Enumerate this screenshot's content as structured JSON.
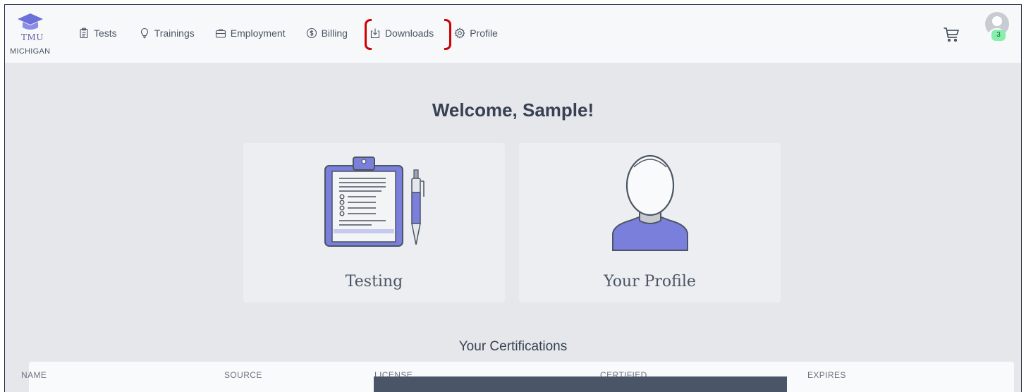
{
  "logo": {
    "title": "TMU",
    "subtitle": "MICHIGAN"
  },
  "nav": {
    "items": [
      {
        "label": "Tests",
        "icon": "clipboard-icon"
      },
      {
        "label": "Trainings",
        "icon": "lightbulb-icon"
      },
      {
        "label": "Employment",
        "icon": "briefcase-icon"
      },
      {
        "label": "Billing",
        "icon": "dollar-icon"
      },
      {
        "label": "Downloads",
        "icon": "download-icon"
      },
      {
        "label": "Profile",
        "icon": "gear-icon"
      }
    ]
  },
  "header": {
    "cart_icon": "cart-icon",
    "avatar_badge": "3"
  },
  "main": {
    "welcome": "Welcome, Sample!",
    "cards": [
      {
        "label": "Testing",
        "icon": "clipboard-pen-illustration"
      },
      {
        "label": "Your Profile",
        "icon": "person-illustration"
      }
    ],
    "certifications_title": "Your Certifications",
    "table_headers": [
      "NAME",
      "SOURCE",
      "LICENSE",
      "CERTIFIED",
      "EXPIRES"
    ]
  },
  "colors": {
    "accent": "#7b7fdc",
    "highlight": "#d00000",
    "badge": "#86efac"
  }
}
